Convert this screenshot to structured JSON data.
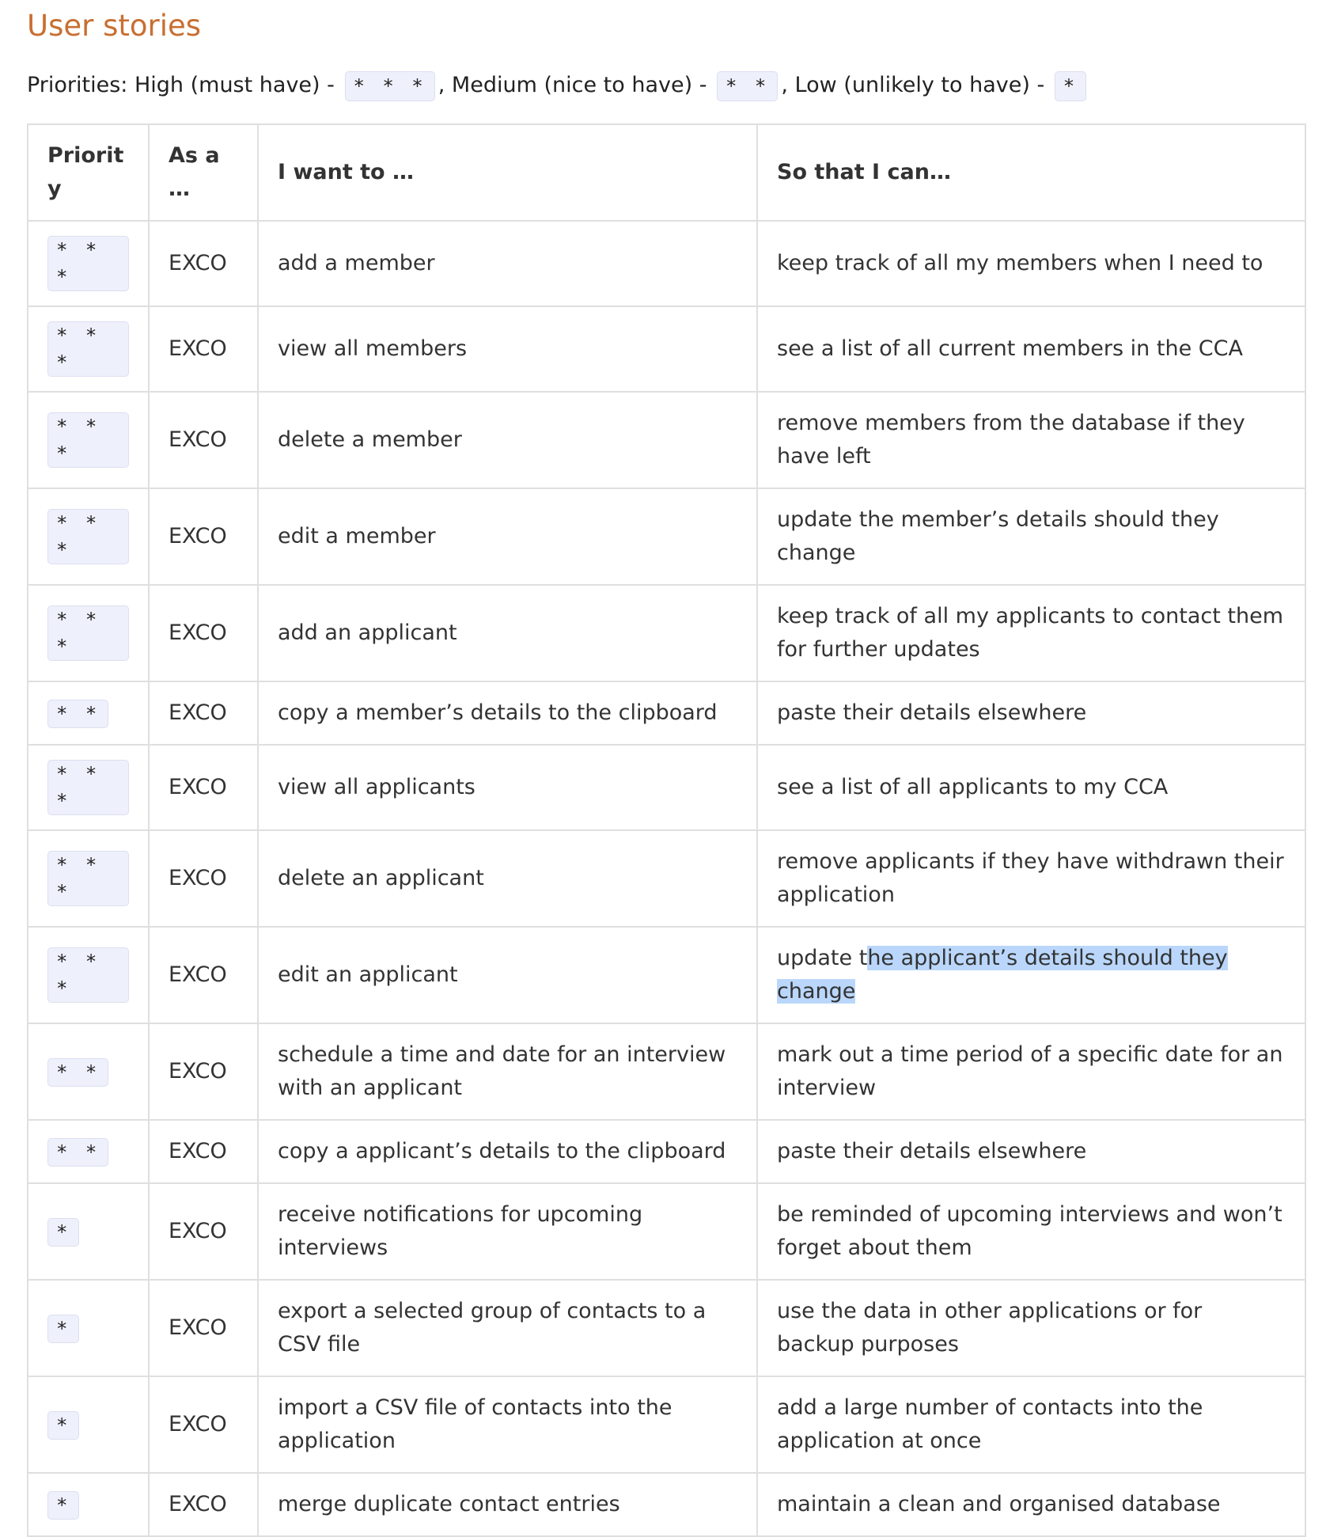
{
  "title": "User stories",
  "legend": {
    "prefix": "Priorities: High (must have) - ",
    "high_code": "* * *",
    "medium_text": ", Medium (nice to have) - ",
    "medium_code": "* *",
    "low_text": ", Low (unlikely to have) - ",
    "low_code": "*"
  },
  "table": {
    "headers": [
      "Priority",
      "As a …",
      "I want to …",
      "So that I can…"
    ],
    "rows": [
      {
        "priority": "* * *",
        "role": "EXCO",
        "want": "add a member",
        "so_that": "keep track of all my members when I need to"
      },
      {
        "priority": "* * *",
        "role": "EXCO",
        "want": "view all members",
        "so_that": "see a list of all current members in the CCA"
      },
      {
        "priority": "* * *",
        "role": "EXCO",
        "want": "delete a member",
        "so_that": "remove members from the database if they have left"
      },
      {
        "priority": "* * *",
        "role": "EXCO",
        "want": "edit a member",
        "so_that": "update the member’s details should they change"
      },
      {
        "priority": "* * *",
        "role": "EXCO",
        "want": "add an applicant",
        "so_that": "keep track of all my applicants to contact them for further updates"
      },
      {
        "priority": "* *",
        "role": "EXCO",
        "want": "copy a member’s details to the clipboard",
        "so_that": "paste their details elsewhere"
      },
      {
        "priority": "* * *",
        "role": "EXCO",
        "want": "view all applicants",
        "so_that": "see a list of all applicants to my CCA"
      },
      {
        "priority": "* * *",
        "role": "EXCO",
        "want": "delete an applicant",
        "so_that": "remove applicants if they have withdrawn their application"
      },
      {
        "priority": "* * *",
        "role": "EXCO",
        "want": "edit an applicant",
        "so_that_plain": "update t",
        "so_that_highlight": "he applicant’s details should they change"
      },
      {
        "priority": "* *",
        "role": "EXCO",
        "want": "schedule a time and date for an interview with an applicant",
        "so_that": "mark out a time period of a specific date for an interview"
      },
      {
        "priority": "* *",
        "role": "EXCO",
        "want": "copy a applicant’s details to the clipboard",
        "so_that": "paste their details elsewhere"
      },
      {
        "priority": "*",
        "role": "EXCO",
        "want": "receive notifications for upcoming interviews",
        "so_that": "be reminded of upcoming interviews and won’t forget about them"
      },
      {
        "priority": "*",
        "role": "EXCO",
        "want": "export a selected group of contacts to a CSV file",
        "so_that": "use the data in other applications or for backup purposes"
      },
      {
        "priority": "*",
        "role": "EXCO",
        "want": "import a CSV file of contacts into the application",
        "so_that": "add a large number of contacts into the application at once"
      },
      {
        "priority": "*",
        "role": "EXCO",
        "want": "merge duplicate contact entries",
        "so_that": "maintain a clean and organised database"
      }
    ]
  },
  "colors": {
    "title": "#c86f32",
    "code_background": "#eef0fb",
    "selection_highlight": "#bad7fb",
    "border": "#dfdfdf"
  }
}
